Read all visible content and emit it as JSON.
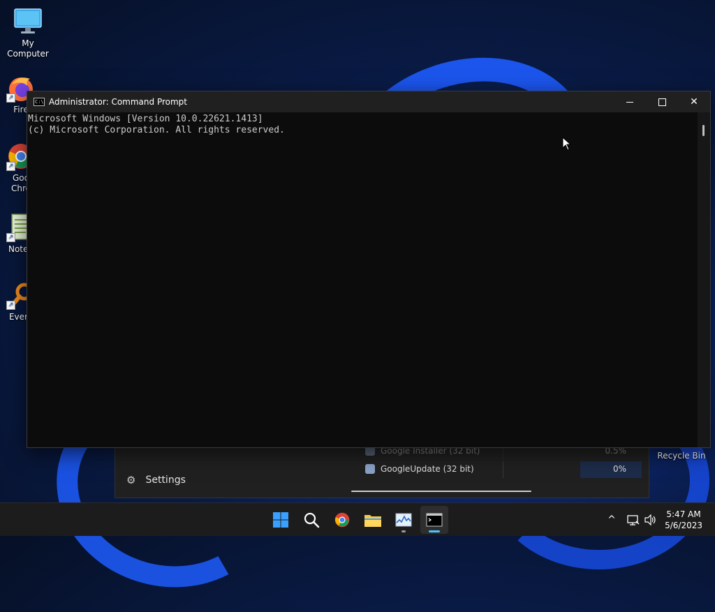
{
  "desktop": {
    "icons": [
      {
        "label": "My Computer",
        "icon": "computer-icon"
      },
      {
        "label": "Fire",
        "icon": "firefox-icon"
      },
      {
        "label": "Goo",
        "label2": "Chro",
        "icon": "chrome-icon"
      },
      {
        "label": "Notep",
        "icon": "notepad-icon"
      },
      {
        "label": "Every",
        "icon": "everything-search-icon"
      }
    ],
    "recycle_bin": "Recycle Bin"
  },
  "task_manager": {
    "settings_label": "Settings",
    "processes": [
      {
        "name": "Google Installer (32 bit)",
        "cpu": "0.5%"
      },
      {
        "name": "GoogleUpdate (32 bit)",
        "cpu": "0%"
      }
    ]
  },
  "cmd_window": {
    "title": "Administrator: Command Prompt",
    "icon_text": "C:\\",
    "lines": [
      "Microsoft Windows [Version 10.0.22621.1413]",
      "(c) Microsoft Corporation. All rights reserved."
    ],
    "close_glyph": "✕"
  },
  "taskbar": {
    "apps": [
      "start-icon",
      "search-icon",
      "chrome-icon",
      "file-explorer-icon",
      "task-manager-icon",
      "command-prompt-icon"
    ],
    "tray_chevron": "^",
    "clock_time": "5:47 AM",
    "clock_date": "5/6/2023"
  },
  "colors": {
    "console_bg": "#0c0c0c",
    "titlebar_bg": "#202020",
    "taskbar_bg": "#1c1c1c",
    "accent": "#4cc2ff"
  }
}
